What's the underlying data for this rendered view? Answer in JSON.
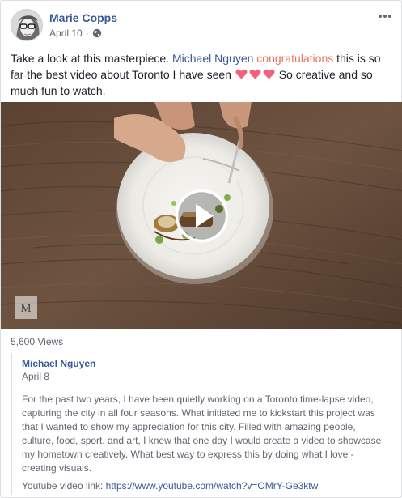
{
  "post": {
    "author": "Marie Copps",
    "date": "April 10",
    "separator": "·",
    "text_parts": {
      "intro": "Take a look at this masterpiece. ",
      "mention": "Michael Nguyen",
      "space1": " ",
      "congrats": "congratulations",
      "body": " this is so far the best video about Toronto I have seen ",
      "tail": " So creative and so much fun to watch."
    },
    "icons": [
      "globe-icon",
      "more-icon",
      "heart-icon",
      "play-icon"
    ],
    "colors": {
      "link": "#385898",
      "congrats": "#e9765b",
      "heart": "#f0637c"
    }
  },
  "video": {
    "views": "5,600 Views",
    "watermark_letter": "M"
  },
  "description": {
    "author": "Michael Nguyen",
    "date": "April 8",
    "body": "For the past two years, I have been quietly working on a Toronto time-lapse video, capturing the city in all four seasons. What initiated me to kickstart this project was that I wanted to show my appreciation for this city. Filled with amazing people, culture, food, sport, and art, I knew that one day I would create a video to showcase my hometown creatively. What best way to express this by doing what I love - creating visuals.",
    "link_label": "Youtube video link: ",
    "link_url": "https://www.youtube.com/watch?v=OMrY-Ge3ktw"
  }
}
